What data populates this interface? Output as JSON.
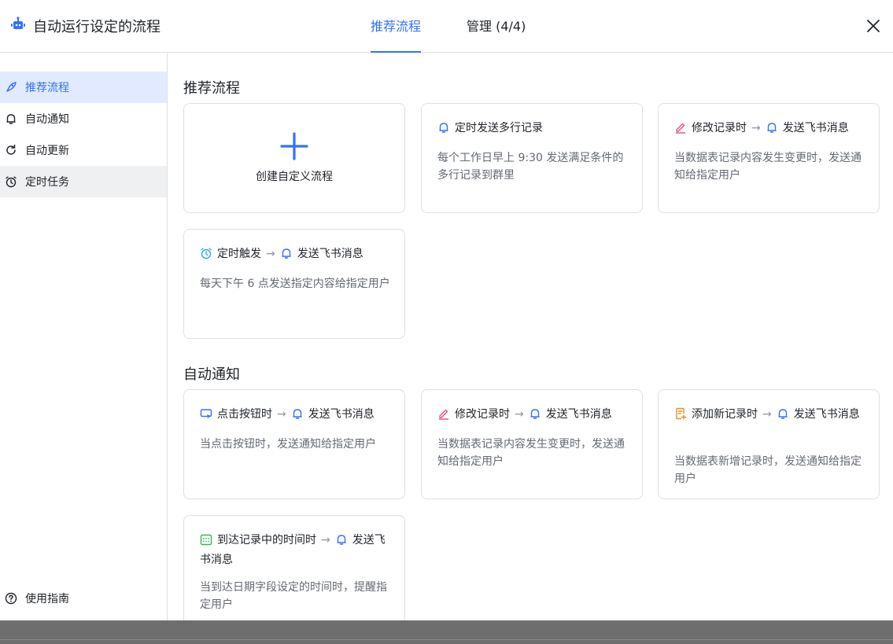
{
  "header": {
    "title": "自动运行设定的流程",
    "tabs": [
      {
        "label": "推荐流程"
      },
      {
        "label": "管理 (4/4)"
      }
    ]
  },
  "sidebar": {
    "items": [
      {
        "label": "推荐流程"
      },
      {
        "label": "自动通知"
      },
      {
        "label": "自动更新"
      },
      {
        "label": "定时任务"
      }
    ],
    "guide": "使用指南"
  },
  "sections": [
    {
      "title": "推荐流程",
      "create_label": "创建自定义流程",
      "cards": [
        {
          "trigger": "定时发送多行记录",
          "action": "",
          "desc": "每个工作日早上 9:30 发送满足条件的多行记录到群里"
        },
        {
          "trigger": "修改记录时",
          "action": "发送飞书消息",
          "desc": "当数据表记录内容发生变更时，发送通知给指定用户"
        },
        {
          "trigger": "定时触发",
          "action": "发送飞书消息",
          "desc": "每天下午 6 点发送指定内容给指定用户"
        }
      ]
    },
    {
      "title": "自动通知",
      "cards": [
        {
          "trigger": "点击按钮时",
          "action": "发送飞书消息",
          "desc": "当点击按钮时，发送通知给指定用户"
        },
        {
          "trigger": "修改记录时",
          "action": "发送飞书消息",
          "desc": "当数据表记录内容发生变更时，发送通知给指定用户"
        },
        {
          "trigger": "添加新记录时",
          "action": "发送飞书消息",
          "desc": "当数据表新增记录时，发送通知给指定用户"
        },
        {
          "trigger": "到达记录中的时间时",
          "action": "发送飞书消息",
          "desc": "当到达日期字段设定的时间时，提醒指定用户"
        }
      ]
    }
  ],
  "arrow": "→",
  "colors": {
    "accent": "#3370ff",
    "edit_icon": "#e0508a",
    "clock_icon": "#33a9e0",
    "add_icon": "#f08a24",
    "calendar_icon": "#34b556"
  }
}
